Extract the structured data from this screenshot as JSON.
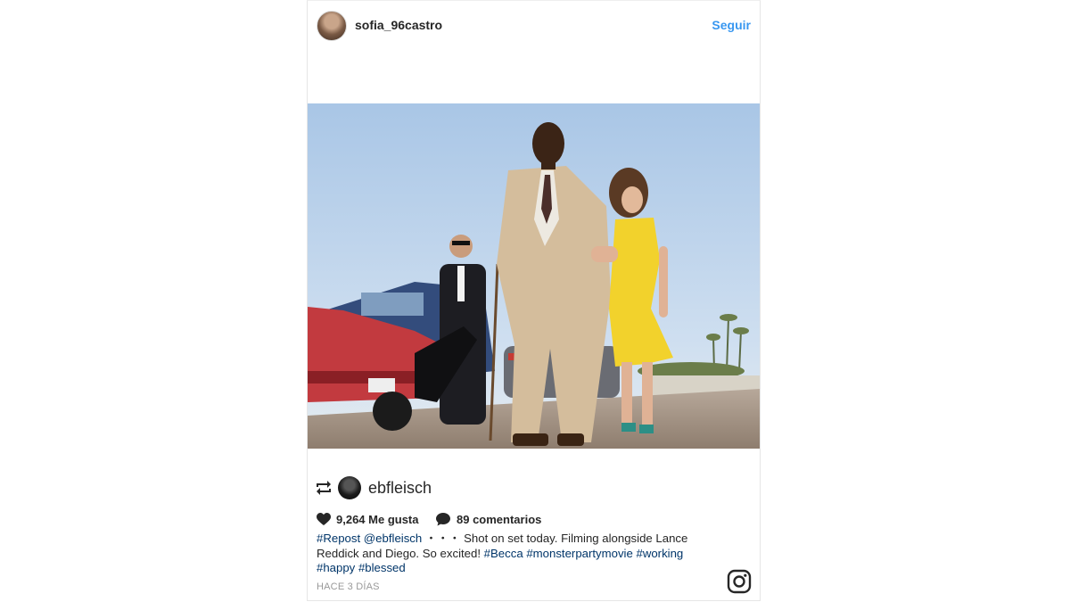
{
  "post": {
    "username": "sofia_96castro",
    "follow_label": "Seguir",
    "repost_username": "ebfleisch",
    "likes": "9,264 Me gusta",
    "comments": "89 comentarios",
    "caption": {
      "line1_tag1": "#Repost",
      "line1_mention": "@ebfleisch",
      "line1_text": " ・・・ Shot on set today. Filming alongside Lance Reddick and Diego. So excited! ",
      "tag_becca": "#Becca",
      "tag_monster": "#monsterpartymovie",
      "tag_working": "#working",
      "tag_happy": "#happy",
      "tag_blessed": "#blessed"
    },
    "timestamp": "HACE 3 DÍAS"
  },
  "icons": {
    "avatar": "profile-avatar",
    "repost": "repost-icon",
    "heart": "heart-icon",
    "comment": "comment-icon",
    "logo": "instagram-logo-icon"
  },
  "colors": {
    "follow_blue": "#3897f0",
    "hashtag": "#003569",
    "text": "#262626",
    "muted": "#999999"
  }
}
